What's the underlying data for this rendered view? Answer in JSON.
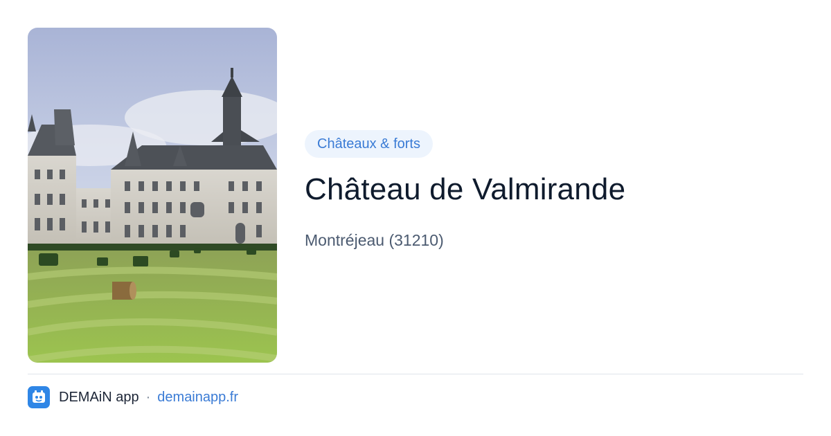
{
  "photo": {
    "alt": "Château de Valmirande"
  },
  "place": {
    "category": "Châteaux & forts",
    "title": "Château de Valmirande",
    "location": "Montréjeau (31210)"
  },
  "footer": {
    "app_name": "DEMAiN app",
    "separator": "·",
    "url": "demainapp.fr"
  },
  "colors": {
    "accent": "#3a7bd5",
    "badge_bg": "#edf4fd",
    "title": "#0f1b2d",
    "subtitle": "#4b5a70",
    "logo_bg": "#2f86e6"
  },
  "icons": {
    "logo": "demain-app-logo-icon"
  }
}
